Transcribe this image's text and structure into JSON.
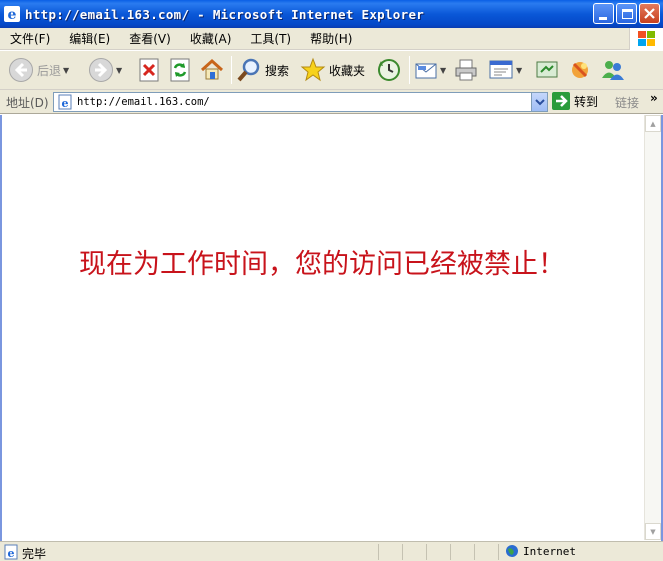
{
  "window": {
    "title": "http://email.163.com/ - Microsoft Internet Explorer"
  },
  "menu": [
    "文件(F)",
    "编辑(E)",
    "查看(V)",
    "收藏(A)",
    "工具(T)",
    "帮助(H)"
  ],
  "toolbar": {
    "back_label": "后退",
    "search_label": "搜索",
    "favorites_label": "收藏夹"
  },
  "address": {
    "label": "地址(D)",
    "url": "http://email.163.com/",
    "go_label": "转到",
    "links_label": "链接",
    "more": "»"
  },
  "content": {
    "message": "现在为工作时间，您的访问已经被禁止！",
    "message_color": "#c8131b"
  },
  "status": {
    "text": "完毕",
    "zone": "Internet"
  },
  "colors": {
    "titlebar": "#0a58d8",
    "chrome": "#ece9d8"
  }
}
